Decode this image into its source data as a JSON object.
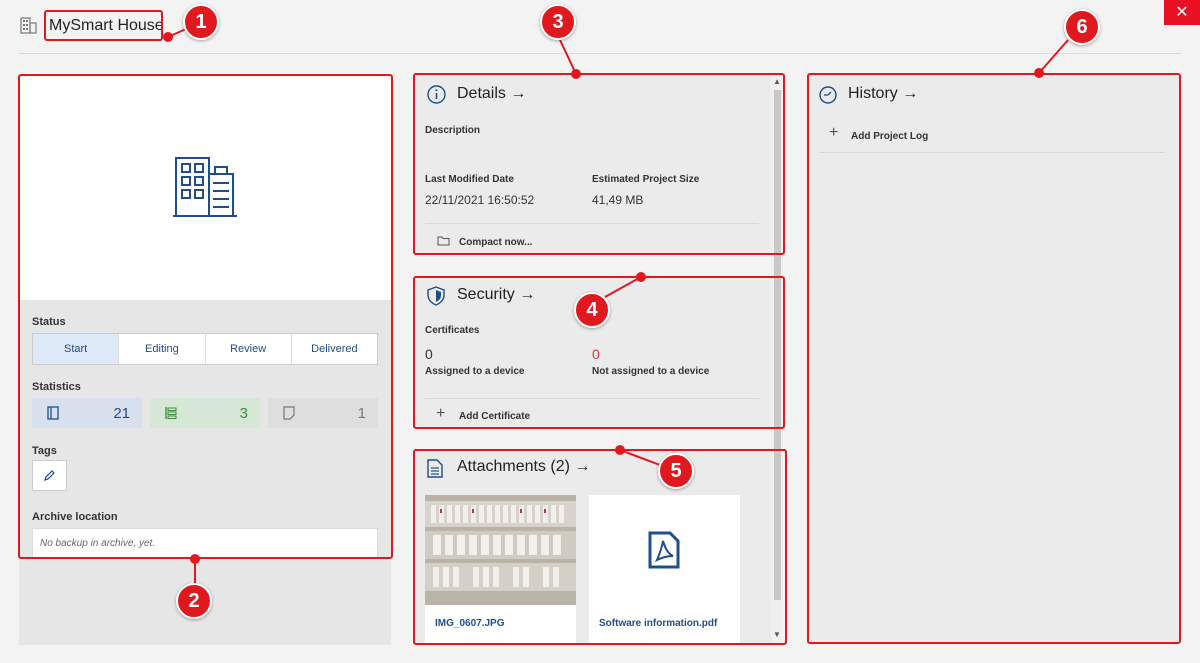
{
  "app": {
    "title": "MySmart House",
    "close_label": "✕"
  },
  "left": {
    "status_label": "Status",
    "stages": [
      "Start",
      "Editing",
      "Review",
      "Delivered"
    ],
    "statistics_label": "Statistics",
    "stats": [
      {
        "value": "21",
        "icon": "device-icon"
      },
      {
        "value": "3",
        "icon": "list-icon"
      },
      {
        "value": "1",
        "icon": "note-icon"
      }
    ],
    "tags_label": "Tags",
    "archive_label": "Archive location",
    "archive_value": "No backup in archive, yet."
  },
  "details": {
    "title": "Details",
    "description_label": "Description",
    "modified_label": "Last Modified Date",
    "modified_value": "22/11/2021 16:50:52",
    "size_label": "Estimated Project Size",
    "size_value": "41,49 MB",
    "compact_label": "Compact now..."
  },
  "security": {
    "title": "Security",
    "certificates_label": "Certificates",
    "assigned_value": "0",
    "assigned_label": "Assigned to a device",
    "not_assigned_value": "0",
    "not_assigned_label": "Not assigned to a device",
    "add_label": "Add Certificate"
  },
  "attachments": {
    "title": "Attachments (2)",
    "files": [
      "IMG_0607.JPG",
      "Software information.pdf"
    ]
  },
  "history": {
    "title": "History",
    "add_label": "Add Project Log"
  },
  "annotations": [
    "1",
    "2",
    "3",
    "4",
    "5",
    "6"
  ],
  "colors": {
    "accent": "#1f4e8a",
    "annotation": "#e0191f",
    "success": "#3c8a3c",
    "warning_value": "#d13438"
  }
}
